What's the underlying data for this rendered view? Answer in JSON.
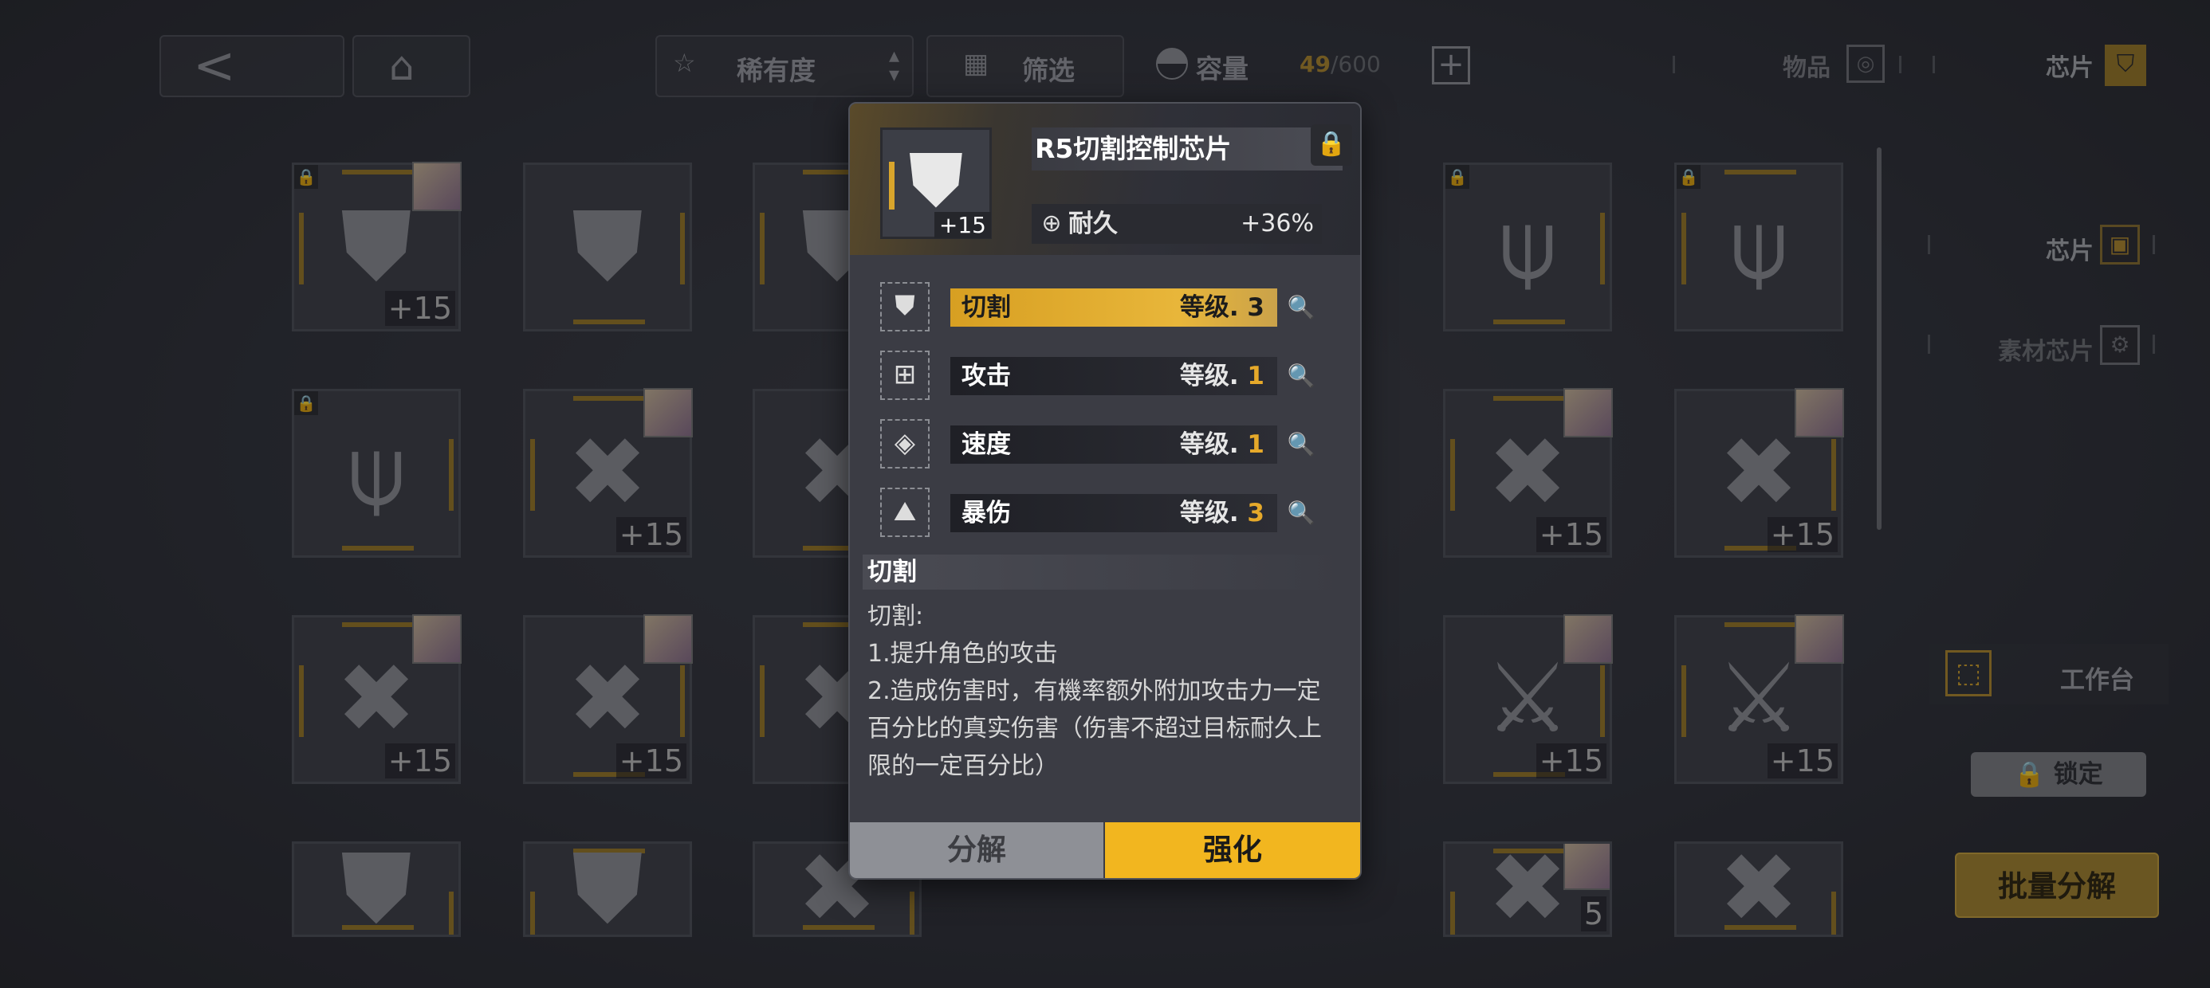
{
  "colors": {
    "accent": "#f2b61f",
    "panel": "#3b3c44",
    "background": "#2e3038"
  },
  "topbar": {
    "back_icon": "back-arrow-icon",
    "home_icon": "home-icon",
    "sort_label": "稀有度",
    "filter_label": "筛选",
    "capacity_label": "容量",
    "capacity_used": "49",
    "capacity_total": "/600",
    "add_icon": "plus-icon",
    "tab_items": "物品",
    "tab_chips": "芯片"
  },
  "grid": {
    "level_badge": "+15",
    "slots": [
      {
        "glyph": "⛊",
        "portrait": true,
        "lock": true,
        "level": "+15"
      },
      {
        "glyph": "⛊",
        "portrait": false,
        "lock": false,
        "level": ""
      },
      {
        "glyph": "⛊",
        "portrait": false,
        "lock": false,
        "level": ""
      },
      {
        "glyph": "⛊",
        "portrait": false,
        "lock": false,
        "level": ""
      },
      {
        "glyph": "⛊",
        "portrait": false,
        "lock": false,
        "level": ""
      },
      {
        "glyph": "⍦",
        "portrait": false,
        "lock": true,
        "level": ""
      },
      {
        "glyph": "⍦",
        "portrait": false,
        "lock": true,
        "level": ""
      },
      {
        "glyph": "⍦",
        "portrait": false,
        "lock": true,
        "level": ""
      },
      {
        "glyph": "✖",
        "portrait": true,
        "lock": false,
        "level": "+15"
      },
      {
        "glyph": "✖",
        "portrait": false,
        "lock": false,
        "level": ""
      },
      {
        "glyph": "✖",
        "portrait": false,
        "lock": false,
        "level": ""
      },
      {
        "glyph": "✖",
        "portrait": true,
        "lock": false,
        "level": "5"
      },
      {
        "glyph": "✖",
        "portrait": true,
        "lock": false,
        "level": "+15"
      },
      {
        "glyph": "✖",
        "portrait": true,
        "lock": false,
        "level": "+15"
      },
      {
        "glyph": "✖",
        "portrait": true,
        "lock": false,
        "level": "+15"
      },
      {
        "glyph": "✖",
        "portrait": true,
        "lock": false,
        "level": "+15"
      },
      {
        "glyph": "✖",
        "portrait": false,
        "lock": false,
        "level": ""
      },
      {
        "glyph": "✖",
        "portrait": false,
        "lock": false,
        "level": ""
      },
      {
        "glyph": "✖",
        "portrait": true,
        "lock": false,
        "level": "5"
      },
      {
        "glyph": "⚔",
        "portrait": true,
        "lock": false,
        "level": "+15"
      },
      {
        "glyph": "⚔",
        "portrait": true,
        "lock": false,
        "level": "+15"
      }
    ]
  },
  "popup": {
    "chip_name": "R5切割控制芯片",
    "chip_level": "+15",
    "lock_icon": "lock-icon",
    "stat_name": "耐久",
    "stat_value": "+36%",
    "skills": [
      {
        "name": "切割",
        "level_label": "等级.",
        "level": "3"
      },
      {
        "name": "攻击",
        "level_label": "等级.",
        "level": "1"
      },
      {
        "name": "速度",
        "level_label": "等级.",
        "level": "1"
      },
      {
        "name": "暴伤",
        "level_label": "等级.",
        "level": "3"
      }
    ],
    "desc_title": "切割",
    "desc_lines": [
      "切割:",
      "1.提升角色的攻击",
      "2.造成伤害时，有機率额外附加攻击力一定",
      "百分比的真实伤害（伤害不超过目标耐久上",
      "限的一定百分比）"
    ],
    "btn_dismantle": "分解",
    "btn_enhance": "强化"
  },
  "right_panel": {
    "chip_label": "芯片",
    "material_label": "素材芯片",
    "workbench_label": "工作台",
    "lock_label": "锁定",
    "batch_label": "批量分解"
  }
}
